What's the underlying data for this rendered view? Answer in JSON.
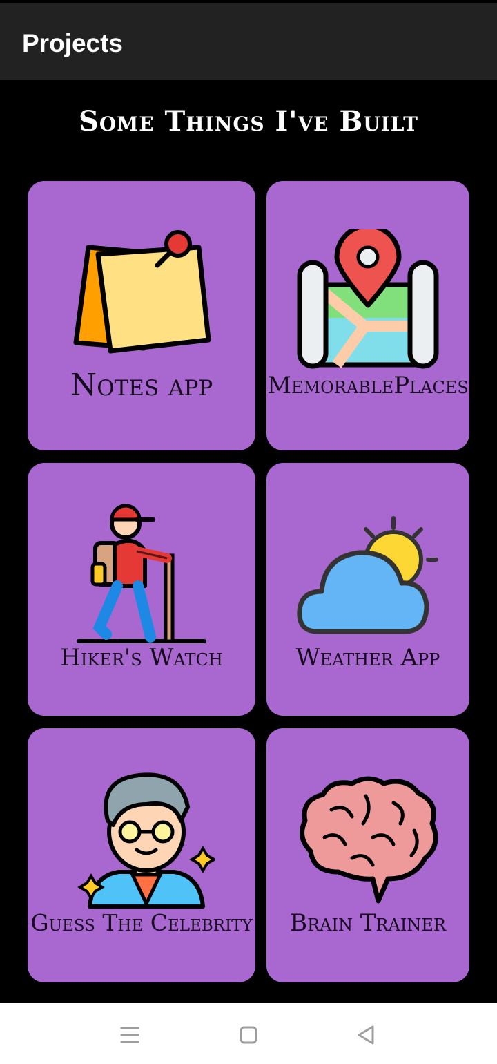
{
  "appbar": {
    "title": "Projects"
  },
  "heading": "Some Things I've Built",
  "projects": [
    {
      "label": "Notes app",
      "icon": "sticky-note-icon"
    },
    {
      "label": "MemorablePlaces",
      "icon": "map-pin-icon"
    },
    {
      "label": "Hiker's Watch",
      "icon": "hiker-icon"
    },
    {
      "label": "Weather App",
      "icon": "weather-icon"
    },
    {
      "label": "Guess The Celebrity",
      "icon": "celebrity-icon"
    },
    {
      "label": "Brain Trainer",
      "icon": "brain-icon"
    }
  ],
  "colors": {
    "card": "#a968d0",
    "appbar": "#222222",
    "background": "#000000"
  },
  "navbar": {
    "icons": [
      "menu-icon",
      "home-icon",
      "back-icon"
    ]
  }
}
